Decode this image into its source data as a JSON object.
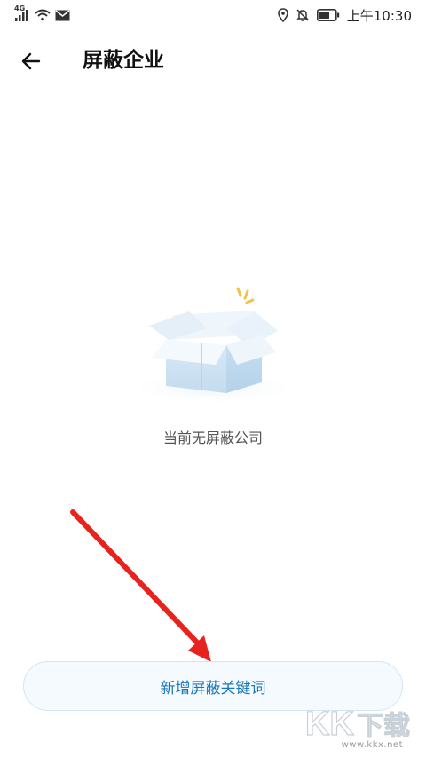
{
  "status_bar": {
    "network": "4G",
    "time": "上午10:30",
    "icons": [
      "signal-icon",
      "wifi-icon",
      "mail-icon",
      "location-icon",
      "mute-icon",
      "battery-icon"
    ]
  },
  "header": {
    "back_icon": "arrow-left-icon",
    "title": "屏蔽企业"
  },
  "empty_state": {
    "icon": "empty-box-icon",
    "message": "当前无屏蔽公司"
  },
  "actions": {
    "add_keyword_label": "新增屏蔽关键词"
  },
  "watermark": {
    "logo_text": "KK下载",
    "url": "www.kkx.net"
  },
  "colors": {
    "accent": "#1a78b8",
    "button_bg": "#f4fafd",
    "annotation": "#e8231e"
  }
}
